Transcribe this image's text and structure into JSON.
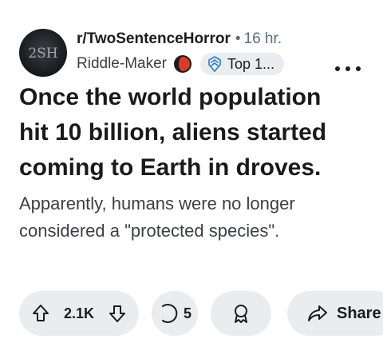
{
  "post": {
    "subreddit": "r/TwoSentenceHorror",
    "separator": "•",
    "time_ago": "16 hr.",
    "author": "Riddle-Maker",
    "badge_label": "Top 1...",
    "avatar_text": "2SH",
    "title": "Once the world population hit 10 billion, aliens started coming to Earth in droves.",
    "body": "Apparently, humans were no longer considered a \"protected species\"."
  },
  "actions": {
    "vote_count": "2.1K",
    "comment_count": "5",
    "share_label": "Share"
  },
  "icons": {
    "avatar": "subreddit-avatar",
    "flair": "half-red-circle-icon",
    "badge": "top-contributor-icon",
    "more": "more-options-icon",
    "upvote": "upvote-arrow-icon",
    "downvote": "downvote-arrow-icon",
    "comment": "comment-bubble-icon",
    "award": "award-icon",
    "share": "share-arrow-icon"
  },
  "colors": {
    "pill_background": "#eaedef",
    "flair_red": "#d93a2b",
    "badge_blue": "#2a7ec8",
    "muted_text": "#576f76"
  }
}
